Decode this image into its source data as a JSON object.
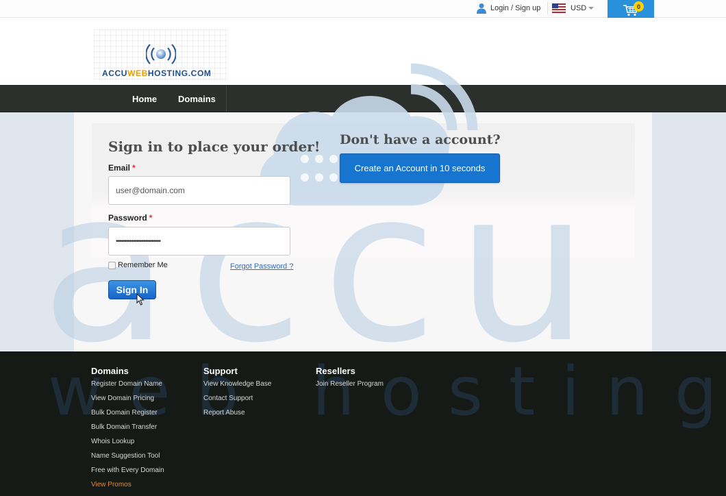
{
  "topbar": {
    "login_label": "Login / Sign up",
    "currency": "USD",
    "cart_count": "0"
  },
  "logo": {
    "text_part1": "ACCU",
    "text_part2": "WEB",
    "text_part3": "HOSTING.COM"
  },
  "nav": {
    "items": [
      {
        "label": "Home"
      },
      {
        "label": "Domains"
      }
    ]
  },
  "signin": {
    "title": "Sign in to place your order!",
    "email_label": "Email",
    "required_mark": "*",
    "email_value": "user@domain.com",
    "password_label": "Password",
    "password_value": "••••••••••••••••••••••••••",
    "remember_label": "Remember Me",
    "forgot_label": "Forgot Password ?",
    "button_label": "Sign In"
  },
  "signup": {
    "title": "Don't have a account?",
    "button_label": "Create an Account in 10 seconds"
  },
  "footer": {
    "columns": [
      {
        "heading": "Domains",
        "links": [
          "Register Domain Name",
          "View Domain Pricing",
          "Bulk Domain Register",
          "Bulk Domain Transfer",
          "Whois Lookup",
          "Name Suggestion Tool",
          "Free with Every Domain",
          "View Promos"
        ]
      },
      {
        "heading": "Support",
        "links": [
          "View Knowledge Base",
          "Contact Support",
          "Report Abuse"
        ]
      },
      {
        "heading": "Resellers",
        "links": [
          "Join Reseller Program"
        ]
      }
    ]
  },
  "watermark": {
    "main": "accu",
    "footer": "web hosting"
  },
  "colors": {
    "accent": "#1775cf",
    "nav_bg": "#2b302d",
    "footer_bg": "#161a17",
    "promo": "#e58a2a",
    "logo_web": "#e7a100"
  }
}
